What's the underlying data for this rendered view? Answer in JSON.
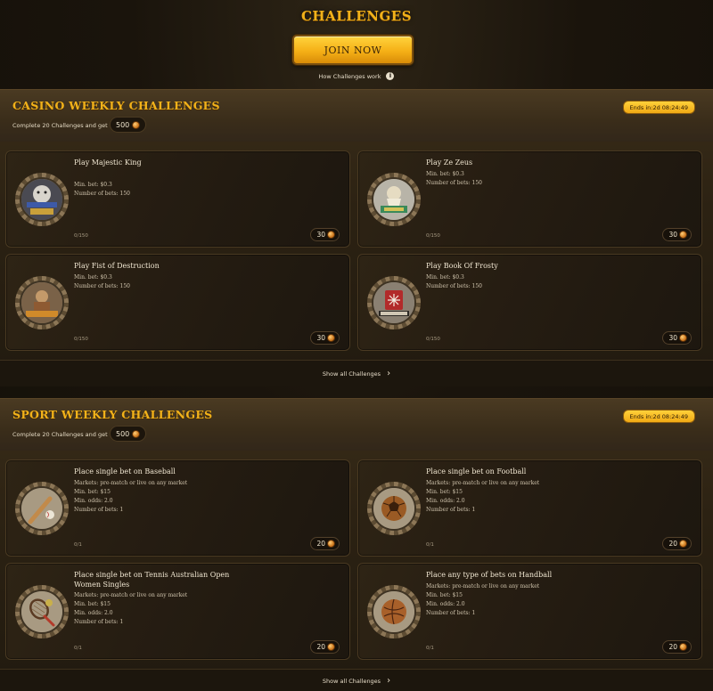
{
  "header": {
    "title": "CHALLENGES",
    "join_label": "JOIN NOW",
    "how_label": "How Challenges work",
    "info_glyph": "i"
  },
  "colors": {
    "accent": "#f2b21a",
    "button_gold": "#f5b016",
    "background": "#1a140c"
  },
  "casino": {
    "title": "CASINO WEEKLY CHALLENGES",
    "subtitle": "Complete 20 Challenges and get",
    "total_reward": "500",
    "ends": "Ends in:2d 08:24:49",
    "show_all": "Show all Challenges",
    "cards": [
      {
        "title": "Play Majestic King",
        "details": [
          "Min. bet: $0.3",
          "Number of bets: 150"
        ],
        "progress": "0/150",
        "reward": "30",
        "icon": "majestic-king-icon"
      },
      {
        "title": "Play Ze Zeus",
        "details": [
          "Min. bet: $0.3",
          "Number of bets: 150"
        ],
        "progress": "0/150",
        "reward": "30",
        "icon": "ze-zeus-icon"
      },
      {
        "title": "Play Fist of Destruction",
        "details": [
          "Min. bet: $0.3",
          "Number of bets: 150"
        ],
        "progress": "0/150",
        "reward": "30",
        "icon": "fist-of-destruction-icon"
      },
      {
        "title": "Play Book Of Frosty",
        "details": [
          "Min. bet: $0.3",
          "Number of bets: 150"
        ],
        "progress": "0/150",
        "reward": "30",
        "icon": "book-of-frosty-icon"
      }
    ]
  },
  "sport": {
    "title": "SPORT WEEKLY CHALLENGES",
    "subtitle": "Complete 20 Challenges and get",
    "total_reward": "500",
    "ends": "Ends in:2d 08:24:49",
    "show_all": "Show all Challenges",
    "cards": [
      {
        "title": "Place single bet on Baseball",
        "details": [
          "Markets: pre-match or live on any market",
          "Min. bet: $15",
          "Min. odds: 2.0",
          "Number of bets: 1"
        ],
        "progress": "0/1",
        "reward": "20",
        "icon": "baseball-icon"
      },
      {
        "title": "Place single bet on Football",
        "details": [
          "Markets: pre-match or live on any market",
          "Min. bet: $15",
          "Min. odds: 2.0",
          "Number of bets: 1"
        ],
        "progress": "0/1",
        "reward": "20",
        "icon": "football-icon"
      },
      {
        "title": "Place single bet on Tennis Australian Open Women Singles",
        "details": [
          "Markets: pre-match or live on any market",
          "Min. bet: $15",
          "Min. odds: 2.0",
          "Number of bets: 1"
        ],
        "progress": "0/1",
        "reward": "20",
        "icon": "tennis-icon"
      },
      {
        "title": "Place any type of bets on Handball",
        "details": [
          "Markets: pre-match or live on any market",
          "Min. bet: $15",
          "Min. odds: 2.0",
          "Number of bets: 1"
        ],
        "progress": "0/1",
        "reward": "20",
        "icon": "handball-icon"
      }
    ]
  }
}
